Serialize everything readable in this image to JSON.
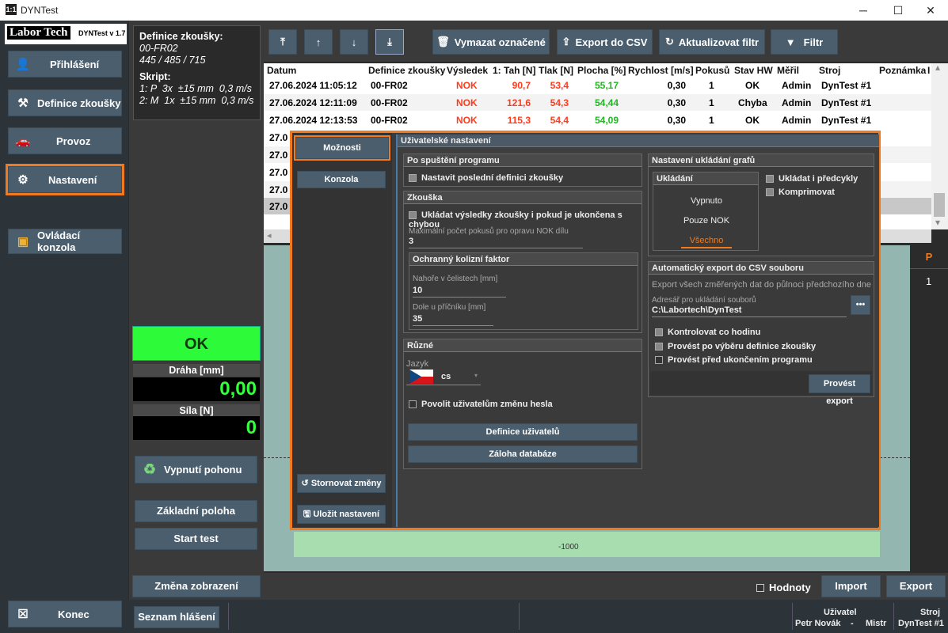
{
  "window": {
    "title": "DYNTest"
  },
  "brand": {
    "name": "Labor Tech",
    "version": "DYNTest v 1.7"
  },
  "nav": {
    "login": "Přihlášení",
    "definition": "Definice zkoušky",
    "operation": "Provoz",
    "settings": "Nastavení",
    "console": "Ovládací konzola",
    "exit": "Konec"
  },
  "definition": {
    "heading": "Definice zkoušky:",
    "code": "00-FR02",
    "values": "445 / 485 / 715",
    "script_heading": "Skript:",
    "script1": "1: P  3x  ±15 mm  0,3 m/s",
    "script2": "2: M  1x  ±15 mm  0,3 m/s"
  },
  "status_panel": {
    "result": "OK",
    "distance_label": "Dráha [mm]",
    "distance_value": "0,00",
    "force_label": "Síla [N]",
    "force_value": "0"
  },
  "actions": {
    "drive_off": "Vypnutí pohonu",
    "home": "Základní poloha",
    "start": "Start test",
    "change_view": "Změna zobrazení"
  },
  "toolbar": {
    "delete": "Vymazat označené",
    "export": "Export do CSV",
    "refresh": "Aktualizovat filtr",
    "filter": "Filtr"
  },
  "table": {
    "headers": [
      "Datum",
      "Definice zkoušky",
      "Výsledek",
      "1: Tah [N]",
      "Tlak [N]",
      "Plocha [%]",
      "Rychlost [m/s]",
      "Pokusů",
      "Stav HW",
      "Měřil",
      "Stroj",
      "Poznámka",
      "I"
    ],
    "rows": [
      [
        "27.06.2024 11:05:12",
        "00-FR02",
        "NOK",
        "90,7",
        "53,4",
        "55,17",
        "0,30",
        "1",
        "OK",
        "Admin",
        "DynTest #1"
      ],
      [
        "27.06.2024 12:11:09",
        "00-FR02",
        "NOK",
        "121,6",
        "54,3",
        "54,44",
        "0,30",
        "1",
        "Chyba",
        "Admin",
        "DynTest #1"
      ],
      [
        "27.06.2024 12:13:53",
        "00-FR02",
        "NOK",
        "115,3",
        "54,4",
        "54,09",
        "0,30",
        "1",
        "OK",
        "Admin",
        "DynTest #1"
      ]
    ],
    "partial_rows": [
      "27.0",
      "27.0",
      "27.0",
      "27.0",
      "27.0"
    ]
  },
  "canvas": {
    "tick": "-1000",
    "pcol_header": "P",
    "pcol_value": "1"
  },
  "bottom": {
    "values_label": "Hodnoty",
    "import": "Import",
    "export": "Export"
  },
  "statusbar": {
    "log": "Seznam hlášení",
    "user_label": "Uživatel",
    "user_name": "Petr Novák",
    "user_sep": "-",
    "user_role": "Mistr",
    "machine_label": "Stroj",
    "machine_name": "DynTest #1"
  },
  "dialog": {
    "tabs": {
      "options": "Možnosti",
      "console": "Konzola",
      "revert": "Stornovat změny",
      "save": "Uložit nastavení"
    },
    "title": "Uživatelské nastavení",
    "startup": {
      "title": "Po spuštění programu",
      "set_last": "Nastavit poslední definici zkoušky"
    },
    "test": {
      "title": "Zkouška",
      "save_results": "Ukládat výsledky zkoušky i pokud je ukončena s chybou",
      "max_attempts_label": "Maximální počet pokusů pro opravu NOK dílu",
      "max_attempts": "3",
      "collision_title": "Ochranný kolizní faktor",
      "top_label": "Nahoře v čelistech [mm]",
      "top_value": "10",
      "bottom_label": "Dole u příčníku [mm]",
      "bottom_value": "35"
    },
    "misc": {
      "title": "Různé",
      "lang_label": "Jazyk",
      "lang_value": "cs",
      "allow_pw": "Povolit uživatelům změnu hesla",
      "users": "Definice uživatelů",
      "backup": "Záloha databáze"
    },
    "graphs": {
      "title": "Nastavení ukládání grafů",
      "save_title": "Ukládání",
      "opt_off": "Vypnuto",
      "opt_nok": "Pouze NOK",
      "opt_all": "Všechno",
      "precycles": "Ukládat i předcykly",
      "compress": "Komprimovat"
    },
    "autoexport": {
      "title": "Automatický export do CSV souboru",
      "desc": "Export všech změřených dat do půlnoci předchozího dne",
      "dir_label": "Adresář pro ukládání souborů",
      "dir_value": "C:\\Labortech\\DynTest",
      "browse": "•••",
      "hourly": "Kontrolovat co hodinu",
      "after_def": "Provést po výběru definice zkoušky",
      "before_exit": "Provést před ukončením programu",
      "run": "Provést export"
    }
  },
  "colors": {
    "accent": "#f07a1d",
    "ok_green": "#2dfb3a",
    "nok_red": "#ff3b1e",
    "button": "#4a5e6e"
  }
}
